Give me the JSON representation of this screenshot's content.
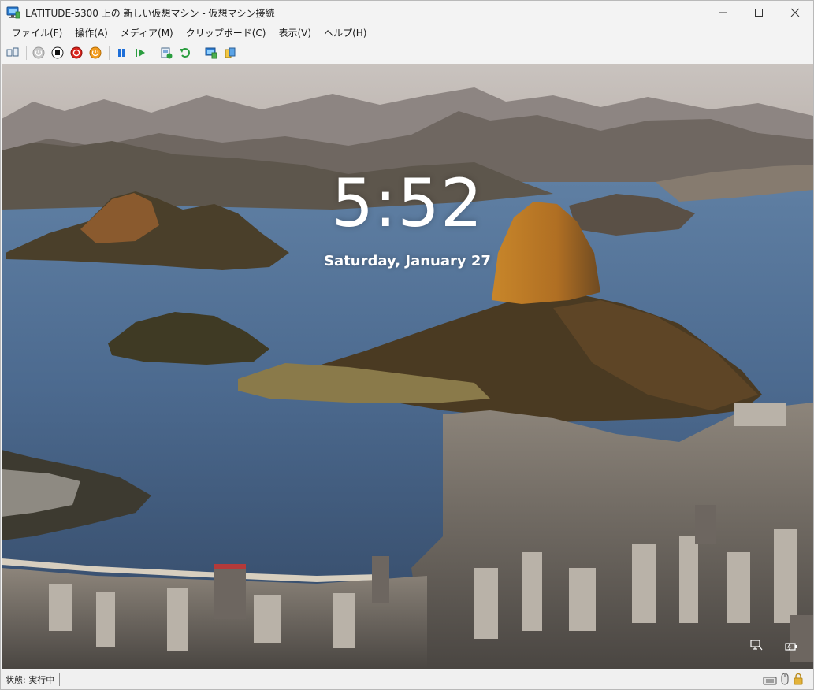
{
  "window": {
    "title": "LATITUDE-5300 上の 新しい仮想マシン - 仮想マシン接続",
    "minimize_icon": "minimize-icon",
    "maximize_icon": "maximize-icon",
    "close_icon": "close-icon"
  },
  "menu": {
    "items": [
      {
        "label": "ファイル(F)"
      },
      {
        "label": "操作(A)"
      },
      {
        "label": "メディア(M)"
      },
      {
        "label": "クリップボード(C)"
      },
      {
        "label": "表示(V)"
      },
      {
        "label": "ヘルプ(H)"
      }
    ]
  },
  "toolbar": {
    "buttons": [
      {
        "icon": "ctrl-alt-del-icon"
      },
      {
        "icon": "start-icon"
      },
      {
        "icon": "turn-off-icon"
      },
      {
        "icon": "shutdown-icon"
      },
      {
        "icon": "save-icon"
      },
      {
        "icon": "pause-icon"
      },
      {
        "icon": "resume-icon"
      },
      {
        "icon": "checkpoint-icon"
      },
      {
        "icon": "revert-icon"
      },
      {
        "icon": "enhanced-session-icon"
      },
      {
        "icon": "share-icon"
      }
    ]
  },
  "lockscreen": {
    "time": "5:52",
    "date": "Saturday, January 27"
  },
  "status": {
    "text": "状態: 実行中"
  },
  "colors": {
    "accent": "#0067c0",
    "window_bg": "#f3f3f3",
    "clock_text": "#ffffff"
  }
}
